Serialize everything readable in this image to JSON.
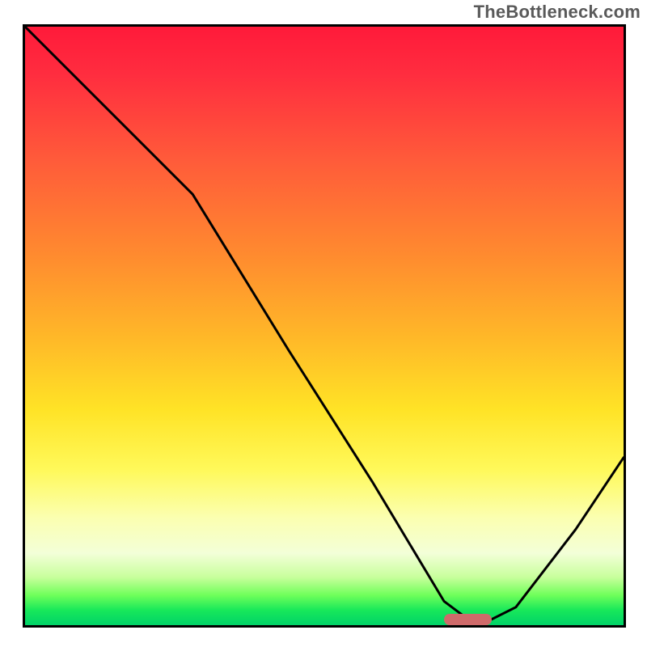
{
  "watermark": "TheBottleneck.com",
  "chart_data": {
    "type": "line",
    "title": "",
    "xlabel": "",
    "ylabel": "",
    "xlim": [
      0,
      100
    ],
    "ylim": [
      0,
      100
    ],
    "grid": false,
    "legend": false,
    "series": [
      {
        "name": "curve",
        "x": [
          0,
          18,
          28,
          44,
          58,
          70,
          74,
          78,
          82,
          92,
          100
        ],
        "y": [
          100,
          82,
          72,
          46,
          24,
          4,
          1,
          1,
          3,
          16,
          28
        ]
      }
    ],
    "marker": {
      "x_range": [
        70,
        78
      ],
      "y": 1
    },
    "background_gradient": {
      "stops": [
        {
          "pos": 0.0,
          "color": "#ff1a3a"
        },
        {
          "pos": 0.38,
          "color": "#ff8a2f"
        },
        {
          "pos": 0.64,
          "color": "#ffe326"
        },
        {
          "pos": 0.88,
          "color": "#f3ffd8"
        },
        {
          "pos": 1.0,
          "color": "#00d268"
        }
      ]
    }
  }
}
